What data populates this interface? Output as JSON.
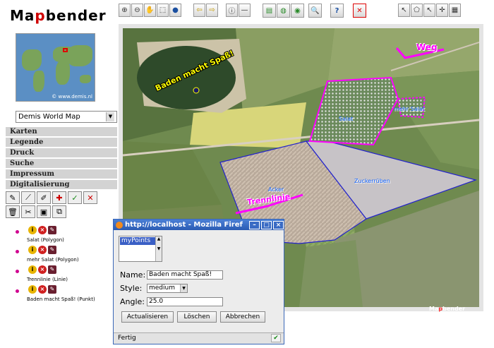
{
  "logo": {
    "text_a": "Ma",
    "text_p": "p",
    "text_b": "bender"
  },
  "overview": {
    "credit": "© www.demis.nl"
  },
  "map_select": {
    "value": "Demis World Map"
  },
  "accordion": [
    {
      "label": "Karten"
    },
    {
      "label": "Legende"
    },
    {
      "label": "Druck"
    },
    {
      "label": "Suche"
    },
    {
      "label": "Impressum"
    },
    {
      "label": "Digitalisierung"
    }
  ],
  "features": [
    {
      "label": "Salat (Polygon)"
    },
    {
      "label": "mehr Salat (Polygon)"
    },
    {
      "label": "Trennlinie (Linie)"
    },
    {
      "label": "Baden macht Spaß! (Punkt)"
    }
  ],
  "map": {
    "labels": {
      "point": "Baden macht Spaß!",
      "weg": "Weg",
      "salat": "Salat",
      "mehr_salat": "mehr Salat",
      "acker": "Acker",
      "trennlinie": "Trennlinie",
      "zuckerrueben": "Zuckerrüben"
    },
    "logo_a": "Ma",
    "logo_p": "p",
    "logo_b": "bender"
  },
  "popup": {
    "title": "http://localhost - Mozilla Firef",
    "list_selected": "myPoints",
    "name_label": "Name:",
    "name_value": "Baden macht Spaß!",
    "style_label": "Style:",
    "style_value": "medium",
    "angle_label": "Angle:",
    "angle_value": "25.0",
    "buttons": {
      "update": "Actualisieren",
      "delete": "Löschen",
      "cancel": "Abbrechen"
    },
    "status": "Fertig"
  },
  "colors": {
    "accent_magenta": "#ff00ff",
    "polygon_blue": "#2222cc",
    "label_blue": "#1565ff",
    "label_yellow": "#ffff00"
  }
}
